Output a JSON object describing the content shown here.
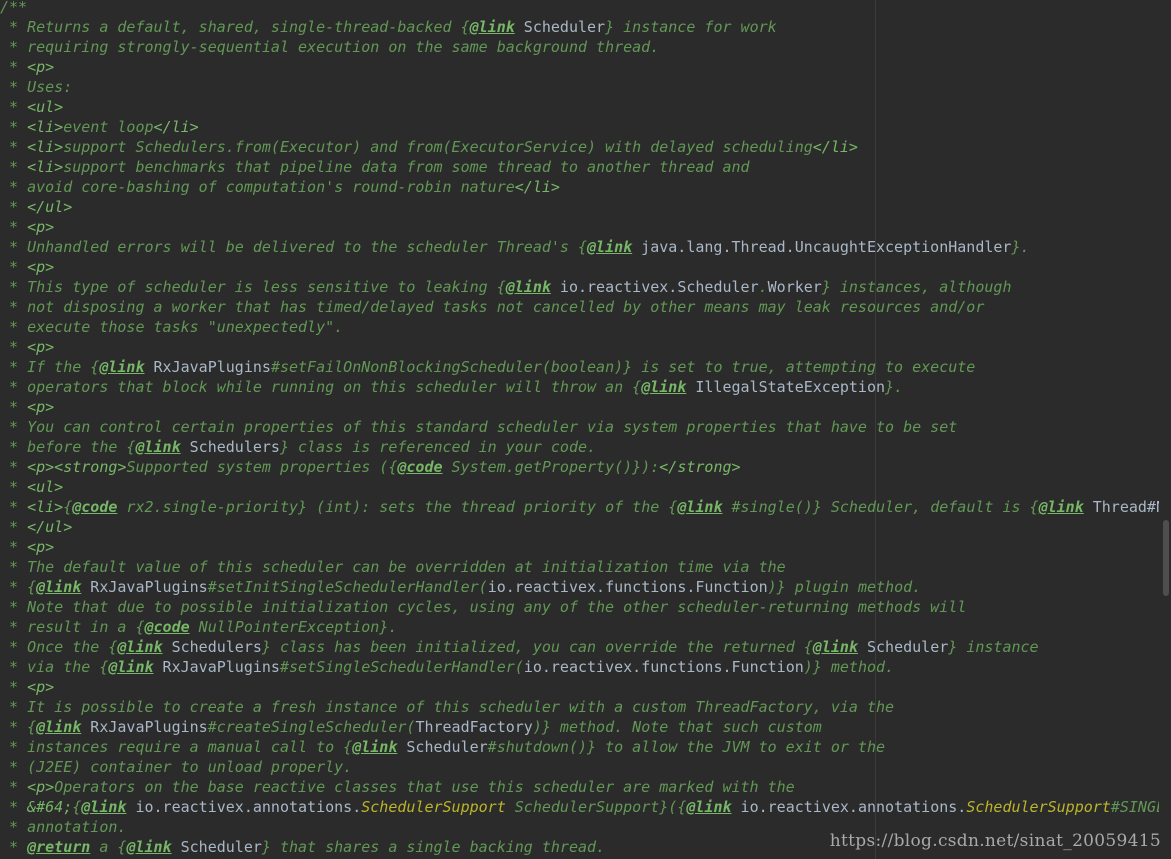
{
  "editor": {
    "lines": [
      [
        {
          "s": "c",
          "t": "/**"
        }
      ],
      [
        {
          "s": "c",
          "t": " * Returns a default, shared, single-thread-backed {"
        },
        {
          "s": "k",
          "t": "@link"
        },
        {
          "s": "r",
          "t": " Scheduler"
        },
        {
          "s": "c",
          "t": "} instance for work"
        }
      ],
      [
        {
          "s": "c",
          "t": " * requiring strongly-sequential execution on the same background thread."
        }
      ],
      [
        {
          "s": "c",
          "t": " * "
        },
        {
          "s": "t",
          "t": "<p>"
        }
      ],
      [
        {
          "s": "c",
          "t": " * Uses:"
        }
      ],
      [
        {
          "s": "c",
          "t": " * "
        },
        {
          "s": "t",
          "t": "<ul>"
        }
      ],
      [
        {
          "s": "c",
          "t": " * "
        },
        {
          "s": "t",
          "t": "<li>"
        },
        {
          "s": "c",
          "t": "event loop"
        },
        {
          "s": "t",
          "t": "</li>"
        }
      ],
      [
        {
          "s": "c",
          "t": " * "
        },
        {
          "s": "t",
          "t": "<li>"
        },
        {
          "s": "c",
          "t": "support Schedulers.from(Executor) and from(ExecutorService) with delayed scheduling"
        },
        {
          "s": "t",
          "t": "</li>"
        }
      ],
      [
        {
          "s": "c",
          "t": " * "
        },
        {
          "s": "t",
          "t": "<li>"
        },
        {
          "s": "c",
          "t": "support benchmarks that pipeline data from some thread to another thread and"
        }
      ],
      [
        {
          "s": "c",
          "t": " * avoid core-bashing of computation's round-robin nature"
        },
        {
          "s": "t",
          "t": "</li>"
        }
      ],
      [
        {
          "s": "c",
          "t": " * "
        },
        {
          "s": "t",
          "t": "</ul>"
        }
      ],
      [
        {
          "s": "c",
          "t": " * "
        },
        {
          "s": "t",
          "t": "<p>"
        }
      ],
      [
        {
          "s": "c",
          "t": " * Unhandled errors will be delivered to the scheduler Thread's {"
        },
        {
          "s": "k",
          "t": "@link"
        },
        {
          "s": "r",
          "t": " java.lang.Thread.UncaughtExceptionHandler"
        },
        {
          "s": "c",
          "t": "}."
        }
      ],
      [
        {
          "s": "c",
          "t": " * "
        },
        {
          "s": "t",
          "t": "<p>"
        }
      ],
      [
        {
          "s": "c",
          "t": " * This type of scheduler is less sensitive to leaking {"
        },
        {
          "s": "k",
          "t": "@link"
        },
        {
          "s": "r",
          "t": " io.reactivex.Scheduler"
        },
        {
          "s": "c",
          "t": "."
        },
        {
          "s": "r",
          "t": "Worker"
        },
        {
          "s": "c",
          "t": "} instances, although"
        }
      ],
      [
        {
          "s": "c",
          "t": " * not disposing a worker that has timed/delayed tasks not cancelled by other means may leak resources and/or"
        }
      ],
      [
        {
          "s": "c",
          "t": " * execute those tasks \"unexpectedly\"."
        }
      ],
      [
        {
          "s": "c",
          "t": " * "
        },
        {
          "s": "t",
          "t": "<p>"
        }
      ],
      [
        {
          "s": "c",
          "t": " * If the {"
        },
        {
          "s": "k",
          "t": "@link"
        },
        {
          "s": "r",
          "t": " RxJavaPlugins"
        },
        {
          "s": "c",
          "t": "#setFailOnNonBlockingScheduler(boolean)} is set to true, attempting to execute"
        }
      ],
      [
        {
          "s": "c",
          "t": " * operators that block while running on this scheduler will throw an {"
        },
        {
          "s": "k",
          "t": "@link"
        },
        {
          "s": "r",
          "t": " IllegalStateException"
        },
        {
          "s": "c",
          "t": "}."
        }
      ],
      [
        {
          "s": "c",
          "t": " * "
        },
        {
          "s": "t",
          "t": "<p>"
        }
      ],
      [
        {
          "s": "c",
          "t": " * You can control certain properties of this standard scheduler via system properties that have to be set"
        }
      ],
      [
        {
          "s": "c",
          "t": " * before the {"
        },
        {
          "s": "k",
          "t": "@link"
        },
        {
          "s": "r",
          "t": " Schedulers"
        },
        {
          "s": "c",
          "t": "} class is referenced in your code."
        }
      ],
      [
        {
          "s": "c",
          "t": " * "
        },
        {
          "s": "t",
          "t": "<p><strong>"
        },
        {
          "s": "c",
          "t": "Supported system properties ({"
        },
        {
          "s": "k",
          "t": "@code"
        },
        {
          "s": "c",
          "t": " System.getProperty()}):"
        },
        {
          "s": "t",
          "t": "</strong>"
        }
      ],
      [
        {
          "s": "c",
          "t": " * "
        },
        {
          "s": "t",
          "t": "<ul>"
        }
      ],
      [
        {
          "s": "c",
          "t": " * "
        },
        {
          "s": "t",
          "t": "<li>"
        },
        {
          "s": "c",
          "t": "{"
        },
        {
          "s": "k",
          "t": "@code"
        },
        {
          "s": "c",
          "t": " rx2.single-priority} (int): sets the thread priority of the {"
        },
        {
          "s": "k",
          "t": "@link"
        },
        {
          "s": "c",
          "t": " #single()} Scheduler, default is {"
        },
        {
          "s": "k",
          "t": "@link"
        },
        {
          "s": "r",
          "t": " Thread#N"
        }
      ],
      [
        {
          "s": "c",
          "t": " * "
        },
        {
          "s": "t",
          "t": "</ul>"
        }
      ],
      [
        {
          "s": "c",
          "t": " * "
        },
        {
          "s": "t",
          "t": "<p>"
        }
      ],
      [
        {
          "s": "c",
          "t": " * The default value of this scheduler can be overridden at initialization time via the"
        }
      ],
      [
        {
          "s": "c",
          "t": " * {"
        },
        {
          "s": "k",
          "t": "@link"
        },
        {
          "s": "r",
          "t": " RxJavaPlugins"
        },
        {
          "s": "c",
          "t": "#setInitSingleSchedulerHandler("
        },
        {
          "s": "r",
          "t": "io.reactivex.functions.Function"
        },
        {
          "s": "c",
          "t": ")} plugin method."
        }
      ],
      [
        {
          "s": "c",
          "t": " * Note that due to possible initialization cycles, using any of the other scheduler-returning methods will"
        }
      ],
      [
        {
          "s": "c",
          "t": " * result in a {"
        },
        {
          "s": "k",
          "t": "@code"
        },
        {
          "s": "c",
          "t": " NullPointerException}."
        }
      ],
      [
        {
          "s": "c",
          "t": " * Once the {"
        },
        {
          "s": "k",
          "t": "@link"
        },
        {
          "s": "r",
          "t": " Schedulers"
        },
        {
          "s": "c",
          "t": "} class has been initialized, you can override the returned {"
        },
        {
          "s": "k",
          "t": "@link"
        },
        {
          "s": "r",
          "t": " Scheduler"
        },
        {
          "s": "c",
          "t": "} instance"
        }
      ],
      [
        {
          "s": "c",
          "t": " * via the {"
        },
        {
          "s": "k",
          "t": "@link"
        },
        {
          "s": "r",
          "t": " RxJavaPlugins"
        },
        {
          "s": "c",
          "t": "#setSingleSchedulerHandler("
        },
        {
          "s": "r",
          "t": "io.reactivex.functions.Function"
        },
        {
          "s": "c",
          "t": ")} method."
        }
      ],
      [
        {
          "s": "c",
          "t": " * "
        },
        {
          "s": "t",
          "t": "<p>"
        }
      ],
      [
        {
          "s": "c",
          "t": " * It is possible to create a fresh instance of this scheduler with a custom ThreadFactory, via the"
        }
      ],
      [
        {
          "s": "c",
          "t": " * {"
        },
        {
          "s": "k",
          "t": "@link"
        },
        {
          "s": "r",
          "t": " RxJavaPlugins"
        },
        {
          "s": "c",
          "t": "#createSingleScheduler("
        },
        {
          "s": "r",
          "t": "ThreadFactory"
        },
        {
          "s": "c",
          "t": ")} method. Note that such custom"
        }
      ],
      [
        {
          "s": "c",
          "t": " * instances require a manual call to {"
        },
        {
          "s": "k",
          "t": "@link"
        },
        {
          "s": "r",
          "t": " Scheduler"
        },
        {
          "s": "c",
          "t": "#shutdown()} to allow the JVM to exit or the"
        }
      ],
      [
        {
          "s": "c",
          "t": " * (J2EE) container to unload properly."
        }
      ],
      [
        {
          "s": "c",
          "t": " * "
        },
        {
          "s": "t",
          "t": "<p>"
        },
        {
          "s": "c",
          "t": "Operators on the base reactive classes that use this scheduler are marked with the"
        }
      ],
      [
        {
          "s": "c",
          "t": " * "
        },
        {
          "s": "t",
          "t": "&#64;"
        },
        {
          "s": "c",
          "t": "{"
        },
        {
          "s": "k",
          "t": "@link"
        },
        {
          "s": "r",
          "t": " io.reactivex.annotations."
        },
        {
          "s": "y",
          "t": "SchedulerSupport"
        },
        {
          "s": "c",
          "t": " SchedulerSupport}({"
        },
        {
          "s": "k",
          "t": "@link"
        },
        {
          "s": "r",
          "t": " io.reactivex.annotations."
        },
        {
          "s": "y",
          "t": "SchedulerSupport"
        },
        {
          "s": "c",
          "t": "#SINGL"
        }
      ],
      [
        {
          "s": "c",
          "t": " * annotation."
        }
      ],
      [
        {
          "s": "c",
          "t": " * "
        },
        {
          "s": "k",
          "t": "@return"
        },
        {
          "s": "c",
          "t": " a {"
        },
        {
          "s": "k",
          "t": "@link"
        },
        {
          "s": "r",
          "t": " Scheduler"
        },
        {
          "s": "c",
          "t": "} that shares a single backing thread."
        }
      ]
    ]
  },
  "watermark": "https://blog.csdn.net/sinat_20059415",
  "colors": {
    "background": "#2b2b2b",
    "doc_comment": "#629755",
    "doc_tag": "#77b767",
    "reference": "#a9b7c6",
    "annotation": "#bbb529"
  }
}
